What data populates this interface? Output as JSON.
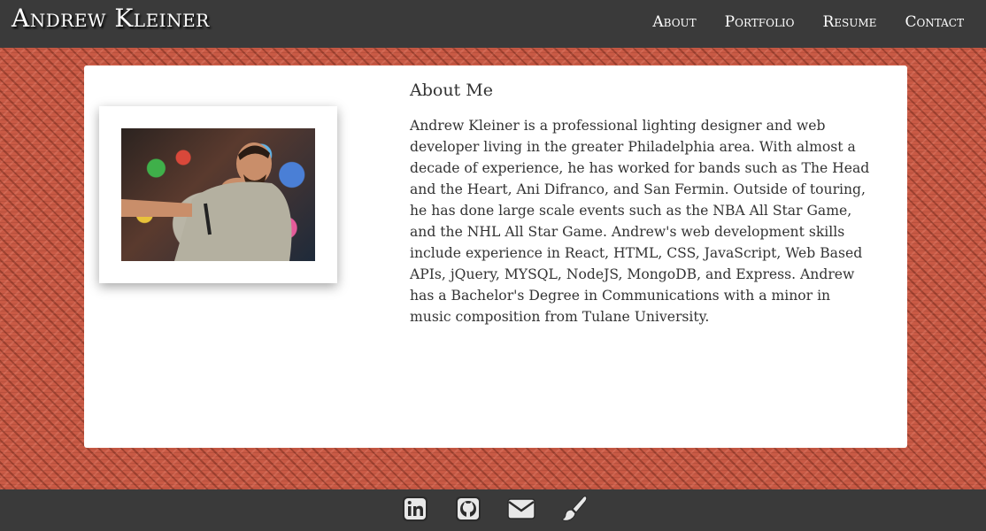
{
  "header": {
    "brand": "Andrew Kleiner",
    "nav": [
      {
        "label": "About"
      },
      {
        "label": "Portfolio"
      },
      {
        "label": "Resume"
      },
      {
        "label": "Contact"
      }
    ]
  },
  "about": {
    "title": "About Me",
    "body": "Andrew Kleiner is a professional lighting designer and web developer living in the greater Philadelphia area. With almost a decade of experience, he has worked for bands such as The Head and the Heart, Ani Difranco, and San Fermin. Outside of touring, he has done large scale events such as the NBA All Star Game, and the NHL All Star Game. Andrew's web development skills include experience in React, HTML, CSS, JavaScript, Web Based APIs, jQuery, MYSQL, NodeJS, MongoDB, and Express. Andrew has a Bachelor's Degree in Communications with a minor in music composition from Tulane University."
  },
  "footer": {
    "icons": [
      "linkedin-icon",
      "github-icon",
      "envelope-icon",
      "paintbrush-icon"
    ]
  },
  "colors": {
    "navbar_bg": "#3a3a3a",
    "background": "#c95a45",
    "card_bg": "#ffffff",
    "text": "#333333"
  }
}
